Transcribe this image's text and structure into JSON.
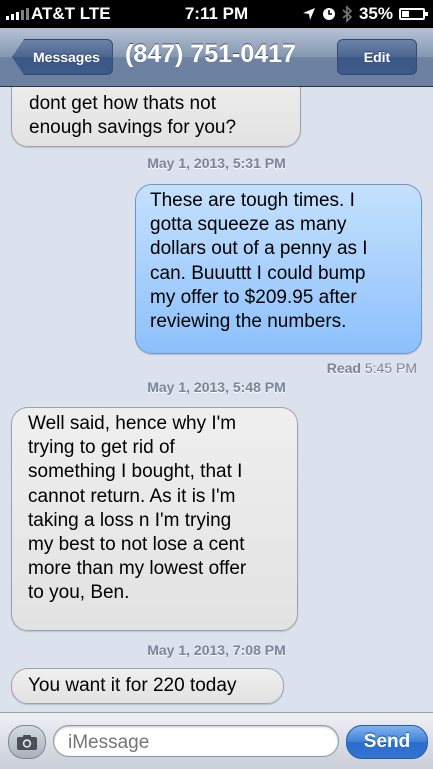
{
  "status_bar": {
    "carrier": "AT&T  LTE",
    "time": "7:11 PM",
    "battery": "35%",
    "battery_level": 0.35,
    "icons": [
      "signal-icon",
      "location-arrow-icon",
      "alarm-icon",
      "bluetooth-icon",
      "battery-icon"
    ]
  },
  "nav": {
    "back_label": "Messages",
    "title": "(847) 751-0417",
    "edit_label": "Edit"
  },
  "thread": {
    "messages": [
      {
        "direction": "incoming",
        "lines": [
          "dont get how thats not",
          "enough savings for you?"
        ]
      },
      {
        "type": "timestamp",
        "text": "May 1, 2013, 5:31 PM"
      },
      {
        "direction": "outgoing",
        "lines": [
          "These are tough times. I",
          "gotta squeeze as many",
          "dollars out of a penny as I",
          "can. Buuuttt I could bump",
          "my offer to $209.95 after",
          "reviewing the numbers."
        ]
      },
      {
        "type": "read_receipt",
        "label": "Read",
        "time": "5:45 PM"
      },
      {
        "type": "timestamp",
        "text": "May 1, 2013, 5:48 PM"
      },
      {
        "direction": "incoming",
        "lines": [
          "Well said, hence why I'm",
          "trying to get rid of",
          "something I bought, that I",
          "cannot return. As it is I'm",
          "taking a loss n I'm trying",
          "my best to not lose a cent",
          "more than my lowest offer",
          "to you, Ben."
        ]
      },
      {
        "type": "timestamp",
        "text": "May 1, 2013, 7:08 PM"
      },
      {
        "direction": "incoming",
        "lines": [
          "You want it for 220 today"
        ]
      }
    ]
  },
  "input_bar": {
    "placeholder": "iMessage",
    "send_label": "Send",
    "camera_icon": "camera-icon"
  },
  "colors": {
    "background": "#dbe2ed",
    "incoming_bubble": "#e6e6e6",
    "outgoing_bubble": "#9ccaf9",
    "send_button": "#3474d2"
  }
}
